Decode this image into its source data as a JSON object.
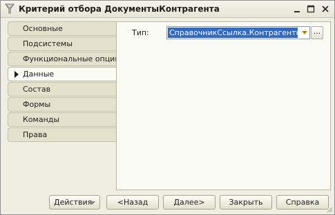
{
  "window": {
    "title": "Критерий отбора ДокументыКонтрагента"
  },
  "tabs": [
    {
      "label": "Основные",
      "active": false
    },
    {
      "label": "Подсистемы",
      "active": false
    },
    {
      "label": "Функциональные опции",
      "active": false
    },
    {
      "label": "Данные",
      "active": true
    },
    {
      "label": "Состав",
      "active": false
    },
    {
      "label": "Формы",
      "active": false
    },
    {
      "label": "Команды",
      "active": false
    },
    {
      "label": "Права",
      "active": false
    }
  ],
  "data_panel": {
    "type_label": "Тип:",
    "type_value": "СправочникСсылка.Контрагенты",
    "ellipsis_label": "..."
  },
  "footer": {
    "actions_label": "Действия",
    "back_label": "<Назад",
    "next_label": "Далее>",
    "close_label": "Закрыть",
    "help_label": "Справка"
  },
  "colors": {
    "selection": "#316ac5",
    "window_bg": "#efeee3",
    "panel_bg": "#fbfbf6",
    "tab_bg": "#e4e1cd"
  }
}
